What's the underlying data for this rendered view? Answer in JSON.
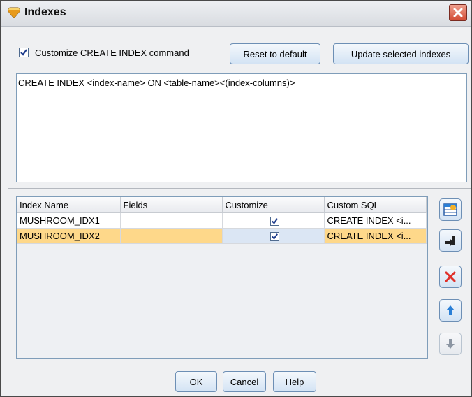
{
  "window": {
    "title": "Indexes",
    "title_icon": "diamond-icon"
  },
  "title_bar": {
    "close_icon": "close-icon"
  },
  "customize_checkbox": {
    "label": "Customize CREATE INDEX command",
    "checked": true
  },
  "buttons": {
    "reset_label": "Reset to default",
    "update_label": "Update selected indexes"
  },
  "sql_template": "CREATE INDEX <index-name> ON <table-name><(index-columns)>",
  "table": {
    "columns": [
      "Index Name",
      "Fields",
      "Customize",
      "Custom SQL"
    ],
    "rows": [
      {
        "index_name": "MUSHROOM_IDX1",
        "fields": "",
        "customize": true,
        "custom_sql": "CREATE INDEX <i...",
        "selected": false
      },
      {
        "index_name": "MUSHROOM_IDX2",
        "fields": "",
        "customize": true,
        "custom_sql": "CREATE INDEX <i...",
        "selected": true
      }
    ]
  },
  "side_buttons": [
    {
      "icon": "add-index-icon",
      "enabled": true
    },
    {
      "icon": "edit-index-icon",
      "enabled": true
    },
    {
      "icon": "delete-icon",
      "enabled": true
    },
    {
      "icon": "move-up-icon",
      "enabled": true
    },
    {
      "icon": "move-down-icon",
      "enabled": false
    }
  ],
  "footer": {
    "ok_label": "OK",
    "cancel_label": "Cancel",
    "help_label": "Help"
  },
  "colors": {
    "selected_row": "#fed88a",
    "delete_red": "#e0302a",
    "accent_blue": "#2a7fd6"
  }
}
